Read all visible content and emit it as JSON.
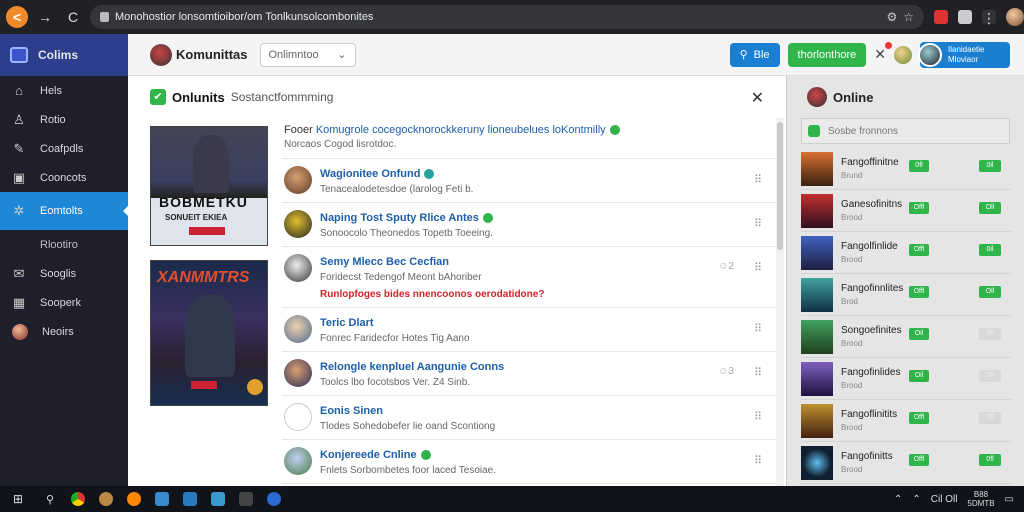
{
  "browser": {
    "url": "Monohostior lonsomtioibor/om Tonlkunsolcombonites",
    "nav_back": "<",
    "nav_forward": "→",
    "nav_reload": "C"
  },
  "sidebar": {
    "title": "Colims",
    "items": [
      {
        "label": "Hels",
        "icon": "home-icon"
      },
      {
        "label": "Rotio",
        "icon": "people-icon"
      },
      {
        "label": "Coafpdls",
        "icon": "gamepad-icon"
      },
      {
        "label": "Cooncots",
        "icon": "chart-icon"
      },
      {
        "label": "Eomtolts",
        "icon": "community-icon",
        "active": true
      },
      {
        "label": "Rlootiro",
        "icon": "",
        "sub": true
      },
      {
        "label": "Sooglis",
        "icon": "mail-icon"
      },
      {
        "label": "Sooperk",
        "icon": "grid-icon"
      },
      {
        "label": "Neoirs",
        "icon": "avatar-icon"
      }
    ]
  },
  "topbar": {
    "brand": "Komunittas",
    "dropdown_value": "Onlimntoo",
    "search_button": "Ble",
    "action_button": "thorlonthore",
    "close_symbol": "✕",
    "profile_button": "Ilanidaetie\nMloviaor"
  },
  "modal": {
    "title": "Onlunits",
    "subtitle": "Sostanctfommming",
    "close_symbol": "✕",
    "poster1": {
      "title": "BOBMETKU",
      "subtitle": "SONUEIT EKIEA"
    },
    "poster2": {
      "title": "XANMMTRS"
    },
    "intro_line1_prefix": "Fooer",
    "intro_line1_link": "Komugrole cocegocknorockkeruny lioneubelues loKontmilly",
    "intro_line2": "Norcaos Cogod lisrotdoc."
  },
  "feed": [
    {
      "name": "Wagionitee Onfund",
      "desc": "Tenacealodetesdoe (larolog Feti b.",
      "badge": "teal",
      "grip": "⠿"
    },
    {
      "name": "Naping Tost Sputy Rlice Antes",
      "desc": "Sonoocolo Theonedos Topetb Toeeing.",
      "badge": "green",
      "grip": "⠿"
    },
    {
      "name": "Semy Mlecc Bec Cecfian",
      "desc": "Foridecst Tedengof Meont bAhoriber",
      "alert": "Runlopfoges bides nnencoonos oerodatidone?",
      "grip": "⠿",
      "emoji": "☺2"
    },
    {
      "name": "Teric Dlart",
      "desc": "Fonrec Faridecfor Hotes Tig Aano",
      "grip": "⠿"
    },
    {
      "name": "Relongle kenpluel Aangunie Conns",
      "desc": "Toolcs lbo focotsbos Ver. Z4 Sinb.",
      "grip": "⠿",
      "emoji": "☺3"
    },
    {
      "name": "Eonis Sinen",
      "desc": "Tlodes Sohedobefer lie oand Scontiong",
      "grip": "⠿"
    },
    {
      "name": "Konjereede Cnline",
      "desc": "Fnlets Sorbombetes foor laced Tesoiae.",
      "badge": "green",
      "grip": "⠿"
    }
  ],
  "right_panel": {
    "title": "Online",
    "search_placeholder": "Sosbe fronnons",
    "rows": [
      {
        "name": "Fangoffinitne",
        "sub": "Brund",
        "b1": "0fl",
        "b2": "0il",
        "b1on": true,
        "b2on": true
      },
      {
        "name": "Ganesofinitns",
        "sub": "Brood",
        "b1": "Offl",
        "b2": "Oll",
        "b1on": true,
        "b2on": true
      },
      {
        "name": "Fangolfinlide",
        "sub": "Brood",
        "b1": "Offl",
        "b2": "0il",
        "b1on": true,
        "b2on": true
      },
      {
        "name": "Fangofinnlites",
        "sub": "Brod",
        "b1": "Offl",
        "b2": "Oll",
        "b1on": true,
        "b2on": true
      },
      {
        "name": "Songoefinites",
        "sub": "Brood",
        "b1": "Oil",
        "b2": "0fl",
        "b1on": true,
        "b2on": false
      },
      {
        "name": "Fangofinlides",
        "sub": "Brood",
        "b1": "Oil",
        "b2": "0fl",
        "b1on": true,
        "b2on": false
      },
      {
        "name": "Fangoflinitits",
        "sub": "Brood",
        "b1": "Offl",
        "b2": "Oll",
        "b1on": true,
        "b2on": false
      },
      {
        "name": "Fangofinitts",
        "sub": "Brood",
        "b1": "Offl",
        "b2": "0fl",
        "b1on": true,
        "b2on": true
      }
    ]
  },
  "taskbar": {
    "tray_text": "Cil Oll",
    "clock": "B88\n5DMTB"
  },
  "colors": {
    "accent_blue": "#1a7fd0",
    "accent_green": "#2fb54a",
    "sidebar_bg": "#1f1f2b",
    "alert_red": "#d0242a"
  }
}
